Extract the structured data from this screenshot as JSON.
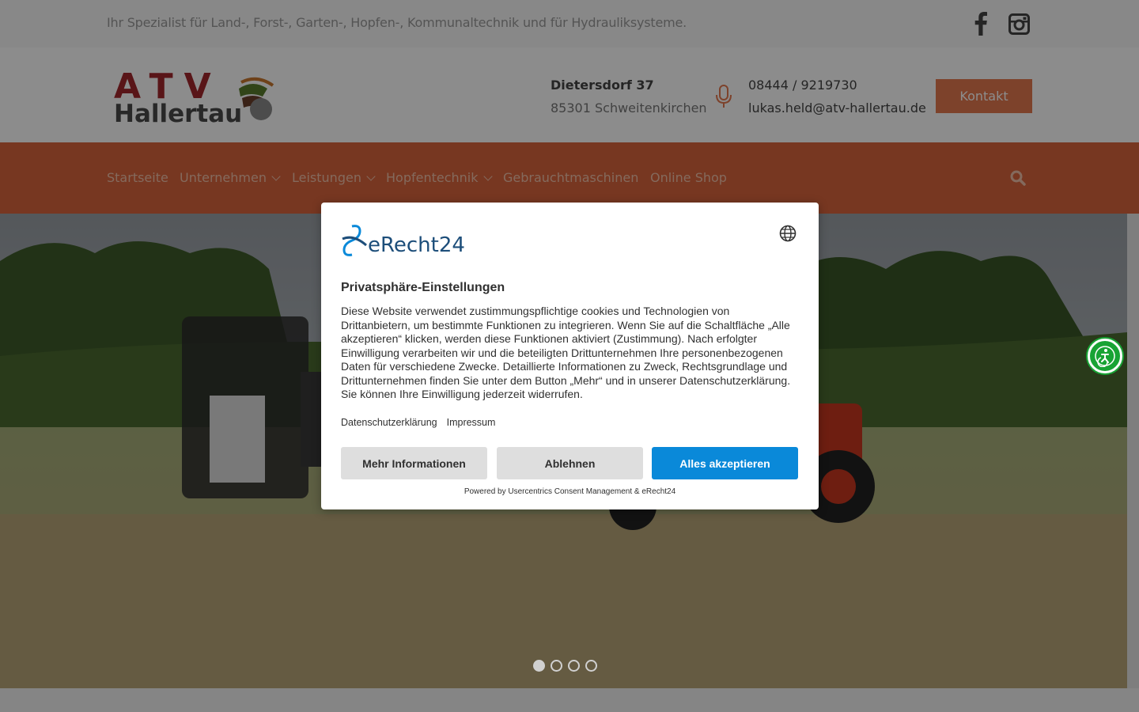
{
  "topbar": {
    "tagline": "Ihr Spezialist für Land-, Forst-, Garten-, Hopfen-, Kommunaltechnik und für Hydrauliksysteme.",
    "social_icons": [
      "facebook-icon",
      "instagram-icon"
    ]
  },
  "header": {
    "logo_text_top": "ATV",
    "logo_text_bottom": "Hallertau",
    "address_line1": "Dietersdorf 37",
    "address_line2": "85301 Schweitenkirchen",
    "phone": "08444 / 9219730",
    "email": "lukas.held@atv-hallertau.de",
    "kontakt_label": "Kontakt"
  },
  "nav": {
    "items": [
      {
        "label": "Startseite",
        "dropdown": false
      },
      {
        "label": "Unternehmen",
        "dropdown": true
      },
      {
        "label": "Leistungen",
        "dropdown": true
      },
      {
        "label": "Hopfentechnik",
        "dropdown": true
      },
      {
        "label": "Gebrauchtmaschinen",
        "dropdown": false
      },
      {
        "label": "Online Shop",
        "dropdown": false
      }
    ]
  },
  "slider": {
    "slide_count": 4,
    "active_slide": 1
  },
  "consent": {
    "brand": "eRecht24",
    "title": "Privatsphäre-Einstellungen",
    "body": "Diese Website verwendet zustimmungspflichtige cookies und Technologien von Drittanbietern, um bestimmte Funktionen zu integrieren. Wenn Sie auf die Schaltfläche „Alle akzeptieren“ klicken, werden diese Funktionen aktiviert (Zustimmung). Nach erfolgter Einwilligung verarbeiten wir und die beteiligten Drittunternehmen Ihre personenbezogenen Daten für verschiedene Zwecke. Detaillierte Informationen zu Zweck, Rechtsgrundlage und Drittunternehmen finden Sie unter dem Button „Mehr“ und in unserer Datenschutzerklärung. Sie können Ihre Einwilligung jederzeit widerrufen.",
    "link_privacy": "Datenschutzerklärung",
    "link_imprint": "Impressum",
    "btn_more": "Mehr Informationen",
    "btn_deny": "Ablehnen",
    "btn_accept": "Alles akzeptieren",
    "powered_by": "Powered by Usercentrics Consent Management & eRecht24"
  },
  "colors": {
    "accent": "#e4784f",
    "nav_bg": "#d9643d",
    "accept_blue": "#0a89d9",
    "a11y_green": "#18a334"
  }
}
